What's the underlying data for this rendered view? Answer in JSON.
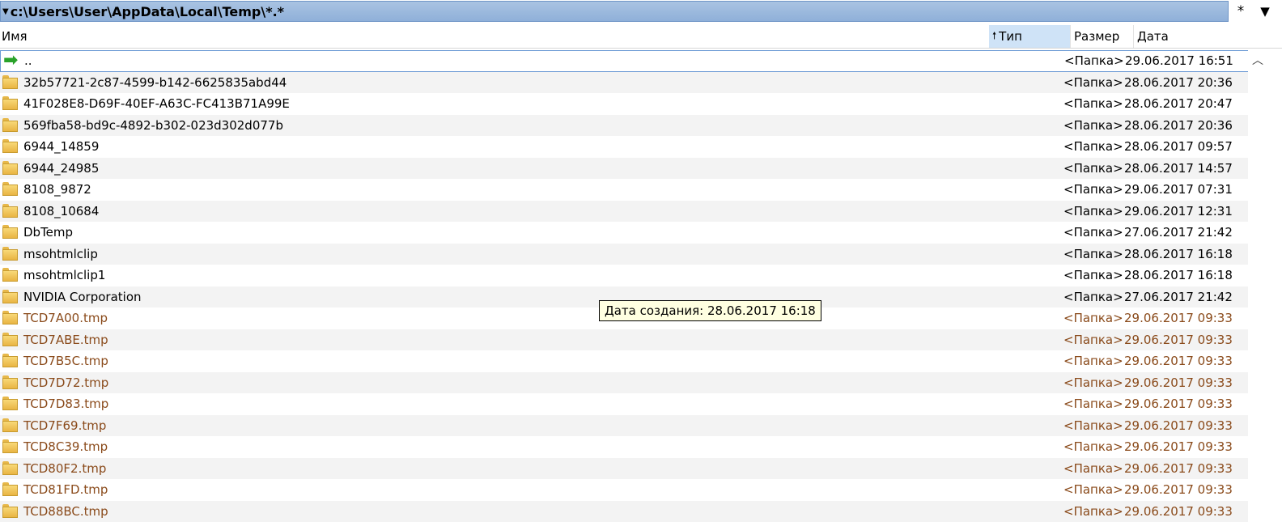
{
  "path_bar": {
    "path": "c:\\Users\\User\\AppData\\Local\\Temp\\*.*",
    "star_button": "*",
    "menu_button": "▼"
  },
  "columns": {
    "name": "Имя",
    "type": "Тип",
    "size": "Размер",
    "date": "Дата"
  },
  "rows": [
    {
      "name": "..",
      "size": "<Папка>",
      "date": "29.06.2017 16:51",
      "kind": "up"
    },
    {
      "name": "32b57721-2c87-4599-b142-6625835abd44",
      "size": "<Папка>",
      "date": "28.06.2017 20:36",
      "kind": "folder"
    },
    {
      "name": "41F028E8-D69F-40EF-A63C-FC413B71A99E",
      "size": "<Папка>",
      "date": "28.06.2017 20:47",
      "kind": "folder"
    },
    {
      "name": "569fba58-bd9c-4892-b302-023d302d077b",
      "size": "<Папка>",
      "date": "28.06.2017 20:36",
      "kind": "folder"
    },
    {
      "name": "6944_14859",
      "size": "<Папка>",
      "date": "28.06.2017 09:57",
      "kind": "folder"
    },
    {
      "name": "6944_24985",
      "size": "<Папка>",
      "date": "28.06.2017 14:57",
      "kind": "folder"
    },
    {
      "name": "8108_9872",
      "size": "<Папка>",
      "date": "29.06.2017 07:31",
      "kind": "folder"
    },
    {
      "name": "8108_10684",
      "size": "<Папка>",
      "date": "29.06.2017 12:31",
      "kind": "folder"
    },
    {
      "name": "DbTemp",
      "size": "<Папка>",
      "date": "27.06.2017 21:42",
      "kind": "folder"
    },
    {
      "name": "msohtmlclip",
      "size": "<Папка>",
      "date": "28.06.2017 16:18",
      "kind": "folder"
    },
    {
      "name": "msohtmlclip1",
      "size": "<Папка>",
      "date": "28.06.2017 16:18",
      "kind": "folder"
    },
    {
      "name": "NVIDIA Corporation",
      "size": "<Папка>",
      "date": "27.06.2017 21:42",
      "kind": "folder"
    },
    {
      "name": "TCD7A00.tmp",
      "size": "<Папка>",
      "date": "29.06.2017 09:33",
      "kind": "tmp"
    },
    {
      "name": "TCD7ABE.tmp",
      "size": "<Папка>",
      "date": "29.06.2017 09:33",
      "kind": "tmp"
    },
    {
      "name": "TCD7B5C.tmp",
      "size": "<Папка>",
      "date": "29.06.2017 09:33",
      "kind": "tmp"
    },
    {
      "name": "TCD7D72.tmp",
      "size": "<Папка>",
      "date": "29.06.2017 09:33",
      "kind": "tmp"
    },
    {
      "name": "TCD7D83.tmp",
      "size": "<Папка>",
      "date": "29.06.2017 09:33",
      "kind": "tmp"
    },
    {
      "name": "TCD7F69.tmp",
      "size": "<Папка>",
      "date": "29.06.2017 09:33",
      "kind": "tmp"
    },
    {
      "name": "TCD8C39.tmp",
      "size": "<Папка>",
      "date": "29.06.2017 09:33",
      "kind": "tmp"
    },
    {
      "name": "TCD80F2.tmp",
      "size": "<Папка>",
      "date": "29.06.2017 09:33",
      "kind": "tmp"
    },
    {
      "name": "TCD81FD.tmp",
      "size": "<Папка>",
      "date": "29.06.2017 09:33",
      "kind": "tmp"
    },
    {
      "name": "TCD88BC.tmp",
      "size": "<Папка>",
      "date": "29.06.2017 09:33",
      "kind": "tmp"
    }
  ],
  "tooltip": {
    "text": "Дата создания: 28.06.2017 16:18"
  },
  "icons": {
    "up": "green-arrow-icon",
    "folder": "folder-icon",
    "scroll_up": "chevron-up-icon"
  },
  "colors": {
    "path_bar": "#9bb8dc",
    "sorted_column": "#cfe3f7",
    "tmp_text": "#8a4a1a",
    "tooltip_bg": "#ffffe1"
  }
}
